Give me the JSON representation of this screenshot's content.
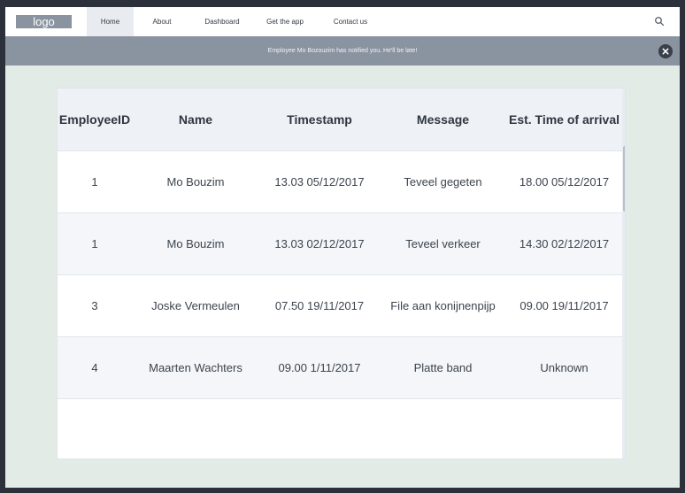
{
  "navbar": {
    "logo": "logo",
    "items": [
      {
        "label": "Home",
        "active": true
      },
      {
        "label": "About",
        "active": false
      },
      {
        "label": "Dashboard",
        "active": false
      },
      {
        "label": "Get the app",
        "active": false
      },
      {
        "label": "Contact us",
        "active": false
      }
    ],
    "search_icon": "search-icon"
  },
  "notification": {
    "text": "Employee Mo Bozouzim has notified you. He'll be late!",
    "close_icon": "close-icon"
  },
  "table": {
    "headers": [
      "EmployeeID",
      "Name",
      "Timestamp",
      "Message",
      "Est. Time of arrival"
    ],
    "rows": [
      [
        "1",
        "Mo Bouzim",
        "13.03 05/12/2017",
        "Teveel gegeten",
        "18.00 05/12/2017"
      ],
      [
        "1",
        "Mo Bouzim",
        "13.03 02/12/2017",
        "Teveel verkeer",
        "14.30 02/12/2017"
      ],
      [
        "3",
        "Joske Vermeulen",
        "07.50 19/11/2017",
        "File aan konijnenpijp",
        "09.00 19/11/2017"
      ],
      [
        "4",
        "Maarten Wachters",
        "09.00 1/11/2017",
        "Platte band",
        "Unknown"
      ]
    ]
  },
  "colors": {
    "background": "#2b303a",
    "canvas": "#e3ebe6",
    "notification_bar": "#8a93a0",
    "active_tab": "#e8ebf0"
  }
}
